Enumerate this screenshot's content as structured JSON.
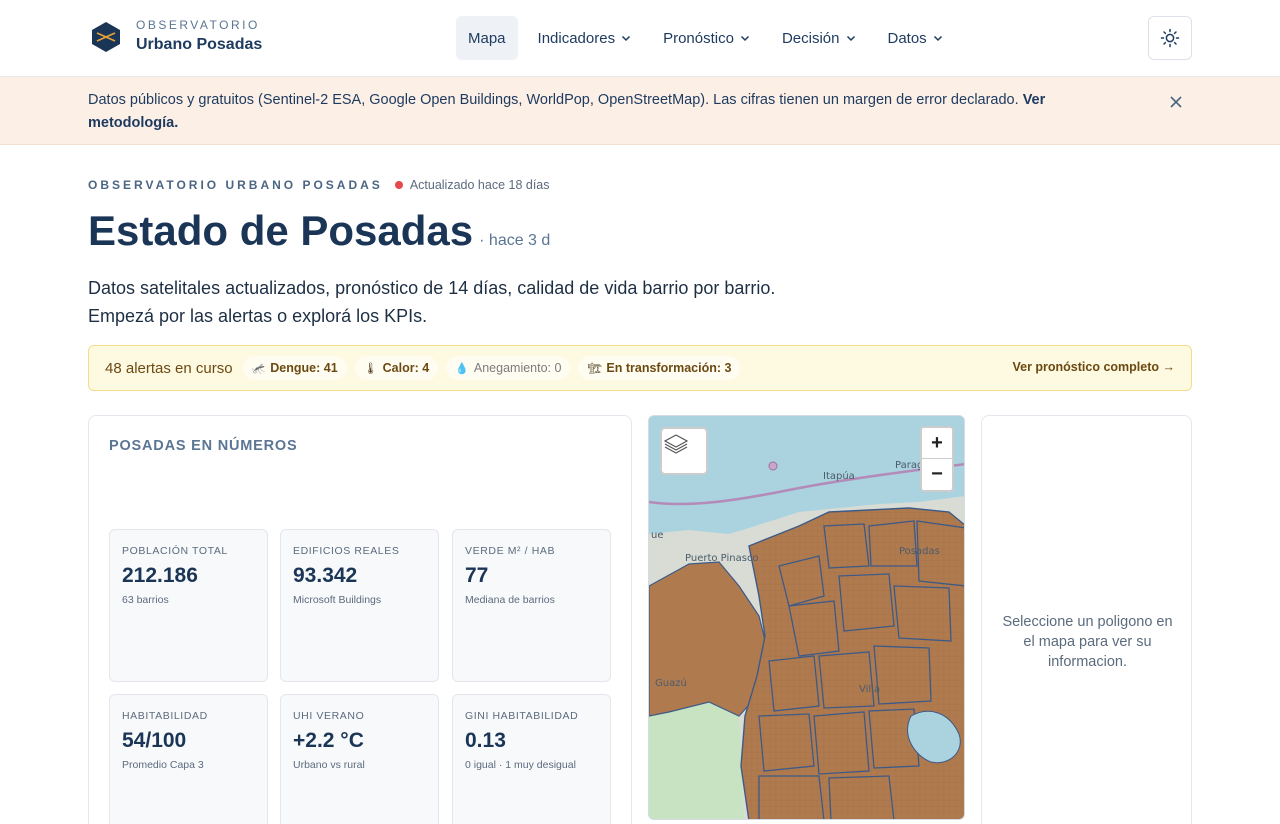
{
  "brand": {
    "kicker": "OBSERVATORIO",
    "name": "Urbano Posadas"
  },
  "nav": {
    "items": [
      {
        "label": "Mapa",
        "active": true,
        "dropdown": false
      },
      {
        "label": "Indicadores",
        "active": false,
        "dropdown": true
      },
      {
        "label": "Pronóstico",
        "active": false,
        "dropdown": true
      },
      {
        "label": "Decisión",
        "active": false,
        "dropdown": true
      },
      {
        "label": "Datos",
        "active": false,
        "dropdown": true
      }
    ],
    "theme_icon": "sun-icon"
  },
  "notice": {
    "text": "Datos públicos y gratuitos (Sentinel-2 ESA, Google Open Buildings, WorldPop, OpenStreetMap). Las cifras tienen un margen de error declarado.",
    "link_label": "Ver metodología.",
    "close_icon": "close-icon"
  },
  "hero": {
    "eyebrow": "OBSERVATORIO URBANO POSADAS",
    "updated": "Actualizado hace 18 días",
    "status_color": "#e5484d",
    "title": "Estado de Posadas",
    "title_since": "· hace 3 d",
    "lead_line1": "Datos satelitales actualizados, pronóstico de 14 días, calidad de vida barrio por barrio.",
    "lead_line2": "Empezá por las alertas o explorá los KPIs."
  },
  "alerts": {
    "count_label": "48 alertas en curso",
    "chips": [
      {
        "icon": "🦟",
        "label": "Dengue: 41"
      },
      {
        "icon": "🌡",
        "label": "Calor: 4"
      },
      {
        "icon": "💧",
        "label": "Anegamiento: 0"
      },
      {
        "icon": "🏗",
        "label": "En transformación: 3"
      }
    ],
    "cta": "Ver pronóstico completo →"
  },
  "kpis": {
    "heading": "POSADAS EN NÚMEROS",
    "cards": [
      {
        "label": "POBLACIÓN TOTAL",
        "value": "212.186",
        "sub": "63 barrios"
      },
      {
        "label": "EDIFICIOS REALES",
        "value": "93.342",
        "sub": "Microsoft Buildings"
      },
      {
        "label": "VERDE M² / HAB",
        "value": "77",
        "sub": "Mediana de barrios"
      },
      {
        "label": "HABITABILIDAD",
        "value": "54/100",
        "sub": "Promedio Capa 3"
      },
      {
        "label": "UHI VERANO",
        "value": "+2.2 °C",
        "sub": "Urbano vs rural"
      },
      {
        "label": "GINI HABITABILIDAD",
        "value": "0.13",
        "sub": "0 igual · 1 muy desigual"
      }
    ]
  },
  "map": {
    "zoom_in": "+",
    "zoom_out": "−",
    "labels": {
      "itapua": "Itapúa",
      "paraguay": "Paraguay",
      "puerto_pinasco": "Puerto Pinasco",
      "posadas": "Posadas",
      "guazu": "Guazú",
      "villa": "Villa",
      "ue": "ue"
    },
    "colors": {
      "water": "#aad3df",
      "land": "#d8dcd5",
      "barrio_fill": "#b07a4f",
      "barrio_stroke": "#3d5a87"
    }
  },
  "info_panel": {
    "text": "Seleccione un poligono en el mapa para ver su informacion."
  }
}
